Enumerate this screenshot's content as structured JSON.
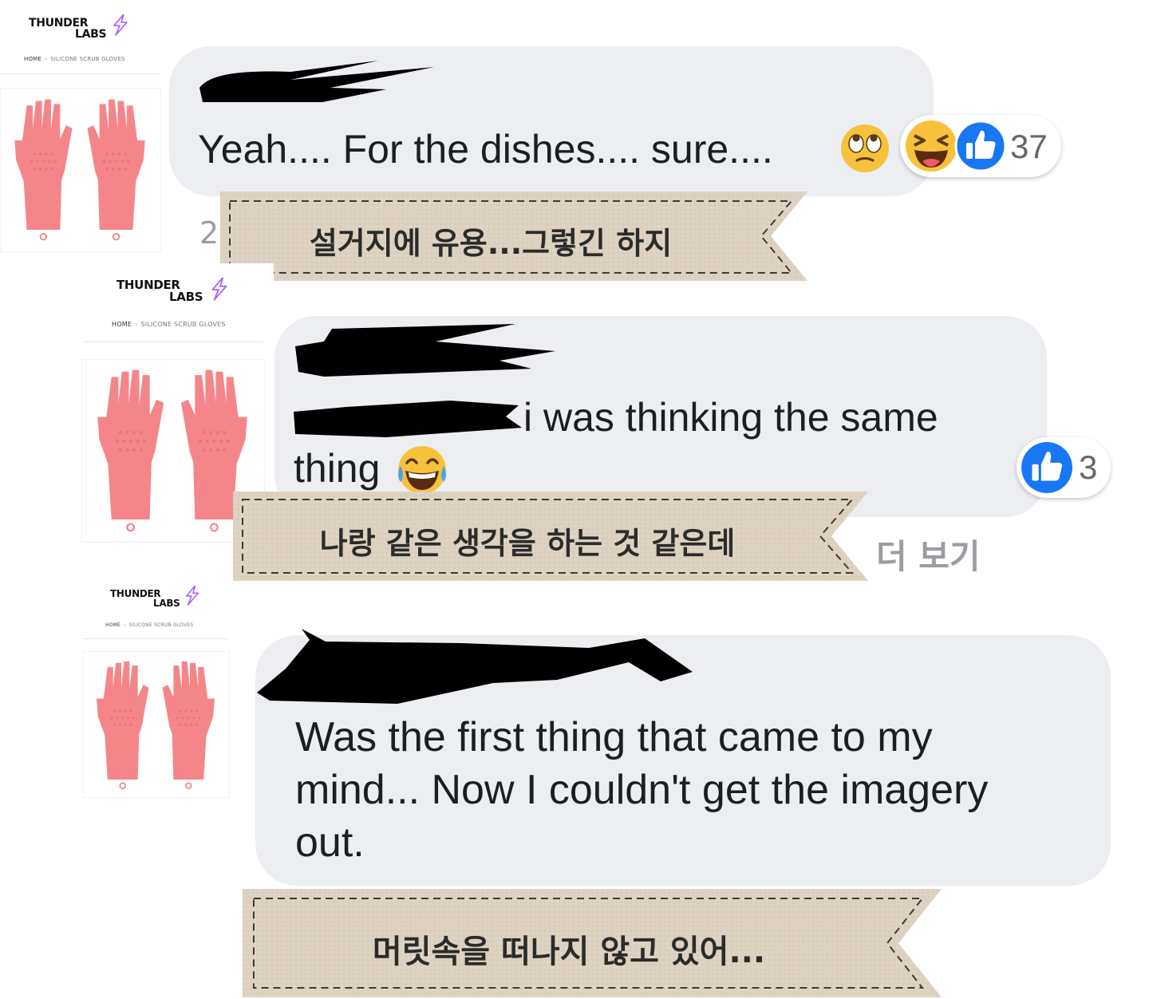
{
  "product": {
    "brand_line1": "THUNDER",
    "brand_line2": "LABS",
    "breadcrumb_home": "HOME",
    "breadcrumb_separator": "›",
    "breadcrumb_current": "SILICONE SCRUB GLOVES",
    "glove_color": "#f4868a",
    "bolt_color": "#a25cff"
  },
  "comments": [
    {
      "text": "Yeah.... For the dishes.... sure....",
      "emoji": "eye-roll-emoji",
      "reactions": [
        "laughing-reaction-icon",
        "like-reaction-icon"
      ],
      "reaction_count": "37",
      "meta_left": "2",
      "translation": "설거지에 유용...그렇긴 하지"
    },
    {
      "text_line1": "i was thinking the same",
      "text_line2": "thing",
      "emoji": "tears-of-joy-emoji",
      "reactions": [
        "like-reaction-icon"
      ],
      "reaction_count": "3",
      "see_more": "더 보기",
      "translation": "나랑 같은 생각을 하는 것 같은데"
    },
    {
      "text_line1": "Was the first thing that came to my",
      "text_line2": "mind... Now I couldn't get the imagery",
      "text_line3": "out.",
      "translation": "머릿속을 떠나지 않고 있어..."
    }
  ],
  "colors": {
    "bubble": "#eceef2",
    "text": "#1c1e21",
    "like_blue": "#1877f2",
    "tag_fabric": "#ddd2c1"
  }
}
